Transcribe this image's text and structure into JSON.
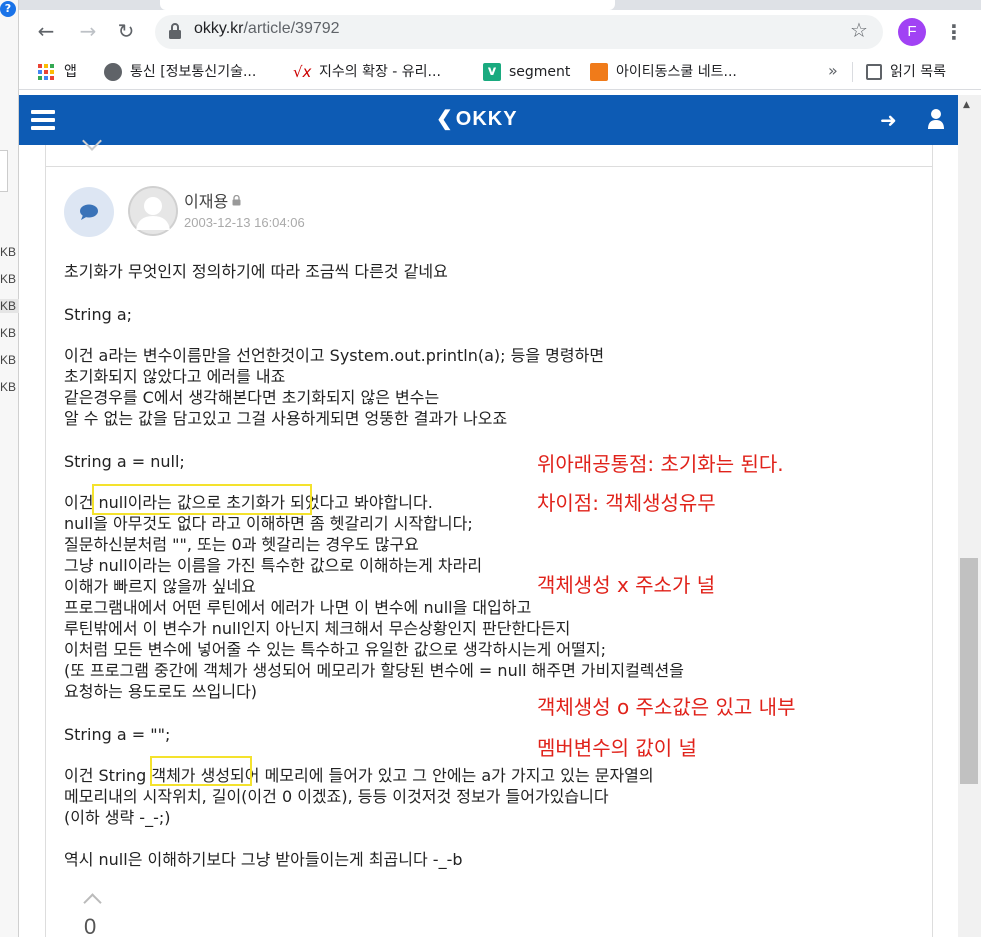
{
  "browser": {
    "url_host": "okky.kr",
    "url_path": "/article/39792",
    "profile_initial": "F",
    "bookmarks": [
      {
        "label": "앱"
      },
      {
        "label": "통신 [정보통신기술..."
      },
      {
        "label": "지수의 확장 - 유리..."
      },
      {
        "label": "segment"
      },
      {
        "label": "아이티동스쿨 네트..."
      }
    ],
    "more_label": "»",
    "reading_list": "읽기 목록"
  },
  "left_strip": {
    "kb_labels": [
      "KB",
      "KB",
      "KB",
      "KB",
      "KB",
      "KB"
    ]
  },
  "site": {
    "logo": "OKKY"
  },
  "post": {
    "author": "이재용",
    "date": "2003-12-13 16:04:06",
    "lines": [
      "초기화가 무엇인지 정의하기에 따라 조금씩 다른것 같네요",
      "String a;",
      "이건 a라는 변수이름만을 선언한것이고 System.out.println(a); 등을 명령하면",
      "초기화되지 않았다고 에러를 내죠",
      "같은경우를 C에서 생각해본다면 초기화되지 않은 변수는",
      "알 수 없는 값을 담고있고 그걸 사용하게되면 엉뚱한 결과가 나오죠",
      "String a = null;",
      "이건 null이라는 값으로 초기화가 되었다고 봐야합니다.",
      "null을 아무것도 없다 라고 이해하면 좀 헷갈리기 시작합니다;",
      "질문하신분처럼 \"\", 또는 0과 헷갈리는 경우도 많구요",
      "그냥 null이라는 이름을 가진 특수한 값으로 이해하는게 차라리",
      "이해가 빠르지 않을까 싶네요",
      "프로그램내에서 어떤 루틴에서 에러가 나면 이 변수에 null을 대입하고",
      "루틴밖에서 이 변수가 null인지 아닌지 체크해서 무슨상황인지 판단한다든지",
      "이처럼 모든 변수에 넣어줄 수 있는 특수하고 유일한 값으로 생각하시는게 어떨지;",
      "(또 프로그램 중간에 객체가 생성되어 메모리가 할당된 변수에 = null 해주면 가비지컬렉션을",
      "요청하는 용도로도 쓰입니다)",
      "String a = \"\";",
      "이건 String 객체가 생성되어 메모리에 들어가 있고 그 안에는 a가 가지고 있는 문자열의",
      "메모리내의 시작위치, 길이(이건 0 이겠죠), 등등 이것저것 정보가 들어가있습니다",
      "(이하 생략 -_-;)",
      "역시 null은 이해하기보다 그냥 받아들이는게 최곱니다 -_-b"
    ],
    "vote_count": "0"
  },
  "annotations": [
    "위아래공통점: 초기화는 된다.",
    "차이점: 객체생성유무",
    "객체생성 x 주소가 널",
    "객체생성 o 주소값은 있고 내부",
    "멤버변수의 값이 널"
  ],
  "colors": {
    "okky_blue": "#0d5bb4",
    "annotation_red": "#e0221a",
    "highlight_yellow": "#f4e22d"
  }
}
